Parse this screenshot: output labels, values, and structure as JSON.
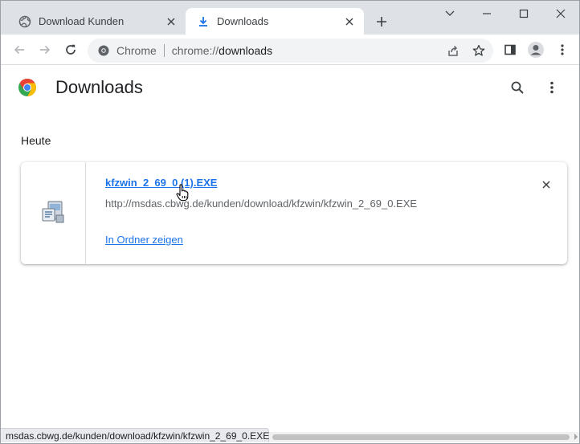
{
  "tabs": [
    {
      "title": "Download Kunden",
      "icon": "globe-icon",
      "active": false
    },
    {
      "title": "Downloads",
      "icon": "download-icon",
      "active": true
    }
  ],
  "omnibox": {
    "chip": "Chrome",
    "url_scheme": "chrome://",
    "url_path": "downloads"
  },
  "page": {
    "title": "Downloads",
    "date_group": "Heute"
  },
  "download_item": {
    "file_name": "kfzwin_2_69_0 (1).EXE",
    "source_url": "http://msdas.cbwg.de/kunden/download/kfzwin/kfzwin_2_69_0.EXE",
    "action_label": "In Ordner zeigen"
  },
  "status_bar": {
    "text": "msdas.cbwg.de/kunden/download/kfzwin/kfzwin_2_69_0.EXE"
  },
  "colors": {
    "tabstrip": "#dee1e6",
    "link": "#1a73e8",
    "secondary_text": "#5f6368"
  }
}
